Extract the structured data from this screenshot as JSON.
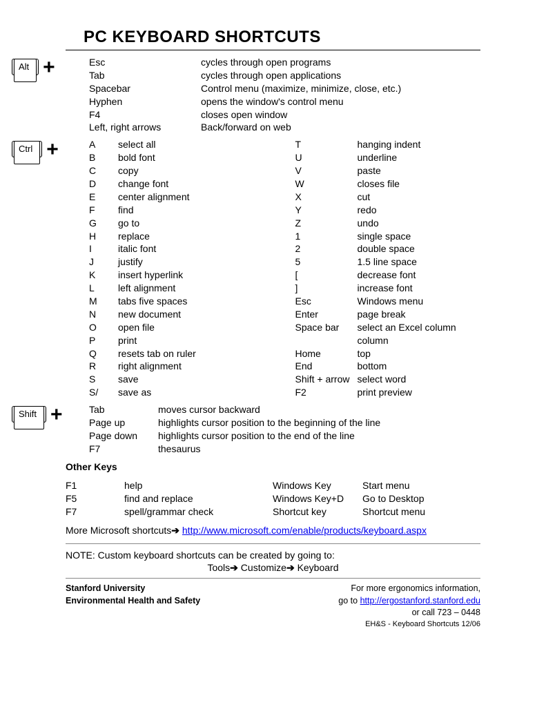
{
  "title": "PC KEYBOARD SHORTCUTS",
  "alt": {
    "label": "Alt",
    "rows": [
      {
        "key": "Esc",
        "desc": "cycles through open programs"
      },
      {
        "key": "Tab",
        "desc": "cycles through open applications"
      },
      {
        "key": "Spacebar",
        "desc": "Control menu (maximize, minimize, close, etc.)"
      },
      {
        "key": "Hyphen",
        "desc": "opens the window's control menu"
      },
      {
        "key": "F4",
        "desc": "closes open window"
      },
      {
        "key": "Left, right arrows",
        "desc": "Back/forward on web"
      }
    ]
  },
  "ctrl": {
    "label": "Ctrl",
    "left": [
      {
        "key": "A",
        "desc": "select all"
      },
      {
        "key": "B",
        "desc": "bold font"
      },
      {
        "key": "C",
        "desc": "copy"
      },
      {
        "key": "D",
        "desc": "change font"
      },
      {
        "key": "E",
        "desc": "center alignment"
      },
      {
        "key": "F",
        "desc": "find"
      },
      {
        "key": "G",
        "desc": "go to"
      },
      {
        "key": "H",
        "desc": "replace"
      },
      {
        "key": "I",
        "desc": "italic font"
      },
      {
        "key": "J",
        "desc": "justify"
      },
      {
        "key": "K",
        "desc": "insert hyperlink"
      },
      {
        "key": "L",
        "desc": "left alignment"
      },
      {
        "key": "M",
        "desc": "tabs five spaces"
      },
      {
        "key": "N",
        "desc": "new document"
      },
      {
        "key": "O",
        "desc": "open file"
      },
      {
        "key": "P",
        "desc": "print"
      },
      {
        "key": "Q",
        "desc": "resets tab on ruler"
      },
      {
        "key": "R",
        "desc": "right alignment"
      },
      {
        "key": "S",
        "desc": "save"
      },
      {
        "key": "S/",
        "desc": "save as"
      }
    ],
    "right": [
      {
        "key": "T",
        "desc": "hanging indent"
      },
      {
        "key": "U",
        "desc": "underline"
      },
      {
        "key": "V",
        "desc": "paste"
      },
      {
        "key": "W",
        "desc": "closes file"
      },
      {
        "key": "X",
        "desc": "cut"
      },
      {
        "key": "Y",
        "desc": "redo"
      },
      {
        "key": "Z",
        "desc": "undo"
      },
      {
        "key": "1",
        "desc": "single space"
      },
      {
        "key": "2",
        "desc": "double space"
      },
      {
        "key": "5",
        "desc": "1.5 line space"
      },
      {
        "key": "[",
        "desc": "decrease font"
      },
      {
        "key": "]",
        "desc": "increase font"
      },
      {
        "key": "Esc",
        "desc": "Windows menu"
      },
      {
        "key": "Enter",
        "desc": "page break"
      },
      {
        "key": "Space bar",
        "desc": "select an Excel column"
      },
      {
        "key": "",
        "desc": ""
      },
      {
        "key": "Home",
        "desc": "top"
      },
      {
        "key": "End",
        "desc": "bottom"
      },
      {
        "key": "Shift + arrow",
        "desc": "select word"
      },
      {
        "key": "F2",
        "desc": "print preview"
      }
    ]
  },
  "shift": {
    "label": "Shift",
    "rows": [
      {
        "key": "Tab",
        "desc": "moves cursor backward"
      },
      {
        "key": "Page up",
        "desc": "highlights cursor position to the beginning of the line"
      },
      {
        "key": "Page down",
        "desc": "highlights cursor position to the end of the line"
      },
      {
        "key": "F7",
        "desc": "thesaurus"
      }
    ]
  },
  "other": {
    "heading": "Other Keys",
    "left": [
      {
        "key": "F1",
        "desc": "help"
      },
      {
        "key": "F5",
        "desc": "find and replace"
      },
      {
        "key": "F7",
        "desc": "spell/grammar check"
      }
    ],
    "right": [
      {
        "key": "Windows Key",
        "desc": "Start menu"
      },
      {
        "key": "Windows Key+D",
        "desc": "Go to Desktop"
      },
      {
        "key": "Shortcut key",
        "desc": "Shortcut menu"
      }
    ]
  },
  "more_prefix": "More Microsoft shortcuts",
  "more_link": "http://www.microsoft.com/enable/products/keyboard.aspx",
  "note_line1": "NOTE: Custom keyboard shortcuts can be created by going to:",
  "note_tools": "Tools",
  "note_customize": "Customize",
  "note_keyboard": "Keyboard",
  "footer": {
    "org1": "Stanford University",
    "org2": "Environmental Health and Safety",
    "info1": "For more ergonomics information,",
    "info2_prefix": "go to ",
    "info2_link": "http://ergostanford.stanford.edu",
    "info3": "or call 723 – 0448",
    "tiny": "EH&S - Keyboard Shortcuts 12/06"
  }
}
